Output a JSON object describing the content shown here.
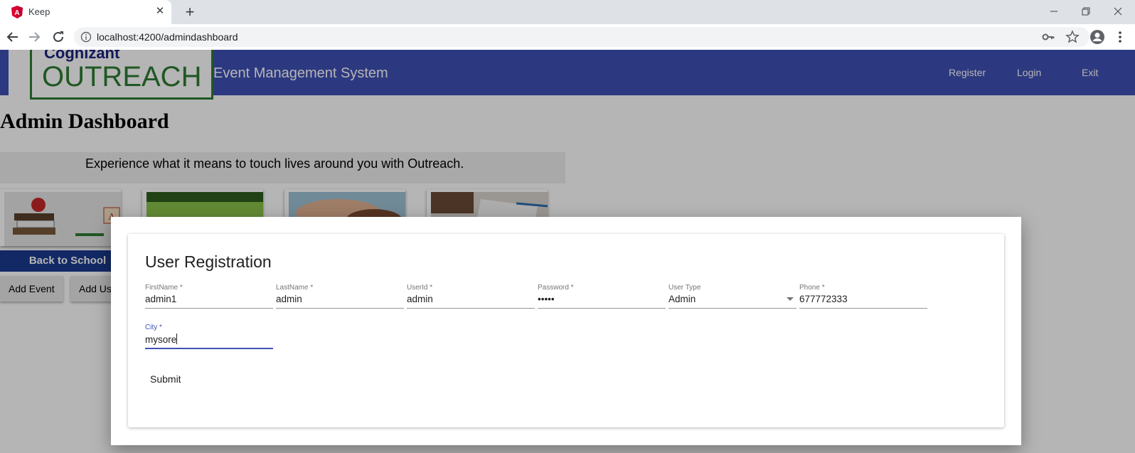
{
  "browser": {
    "tab_title": "Keep",
    "url": "localhost:4200/admindashboard",
    "favicon_color": "#dd0031"
  },
  "header": {
    "logo_brand": "Cognizant",
    "logo_word": "OUTREACH",
    "title": "Event Management System",
    "nav": {
      "register": "Register",
      "login": "Login",
      "exit": "Exit"
    },
    "color": "#3f51b5"
  },
  "dashboard": {
    "title": "Admin Dashboard",
    "tagline": "Experience what it means to touch lives around you with Outreach.",
    "card_caption": "Back to School",
    "buttons": {
      "add_event": "Add Event",
      "add_user": "Add Us"
    }
  },
  "dialog": {
    "title": "User Registration",
    "fields": {
      "first_name": {
        "label": "FirstName *",
        "value": "admin1"
      },
      "last_name": {
        "label": "LastName *",
        "value": "admin"
      },
      "user_id": {
        "label": "UserId *",
        "value": "admin"
      },
      "password": {
        "label": "Password *",
        "value": "•••••"
      },
      "user_type": {
        "label": "User Type",
        "value": "Admin"
      },
      "phone": {
        "label": "Phone *",
        "value": "677772333"
      },
      "city": {
        "label": "City *",
        "value": "mysore"
      }
    },
    "submit_label": "Submit",
    "accent_color": "#3f51b5"
  }
}
